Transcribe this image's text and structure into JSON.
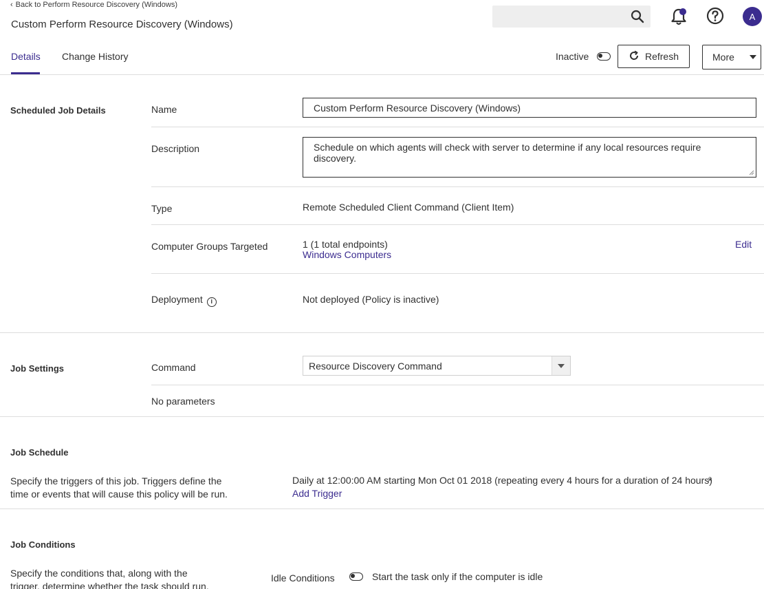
{
  "header": {
    "back_link": "Back to Perform Resource Discovery (Windows)",
    "title": "Custom Perform Resource Discovery (Windows)",
    "search_placeholder": "",
    "avatar_initial": "A"
  },
  "tabs": [
    {
      "label": "Details",
      "active": true
    },
    {
      "label": "Change History",
      "active": false
    }
  ],
  "actions": {
    "status_label": "Inactive",
    "refresh_label": "Refresh",
    "more_label": "More"
  },
  "scheduled_job_details": {
    "title": "Scheduled Job Details",
    "name_label": "Name",
    "name_value": "Custom Perform Resource Discovery (Windows)",
    "description_label": "Description",
    "description_value": "Schedule on which agents will check with server to determine if any local resources require discovery.",
    "type_label": "Type",
    "type_value": "Remote Scheduled Client Command (Client Item)",
    "groups_label": "Computer Groups Targeted",
    "groups_count": "1 (1 total endpoints)",
    "groups_link": "Windows Computers",
    "groups_edit": "Edit",
    "deployment_label": "Deployment",
    "deployment_value": "Not deployed (Policy is inactive)"
  },
  "job_settings": {
    "title": "Job Settings",
    "command_label": "Command",
    "command_value": "Resource Discovery Command",
    "no_parameters": "No parameters"
  },
  "job_schedule": {
    "title": "Job Schedule",
    "description": "Specify the triggers of this job. Triggers define the time or events that will cause this policy will be run.",
    "trigger": "Daily at 12:00:00 AM starting Mon Oct 01 2018 (repeating every 4 hours for a duration of 24 hours)",
    "remove_symbol": "×",
    "add_trigger": "Add Trigger"
  },
  "job_conditions": {
    "title": "Job Conditions",
    "description": "Specify the conditions that, along with the trigger, determine whether the task should run.",
    "idle_label": "Idle Conditions",
    "idle_option": "Start the task only if the computer is idle"
  },
  "colors": {
    "accent": "#3b2c8f",
    "text": "#303030",
    "divider": "#dddddd"
  },
  "icons": [
    "chevron-left-icon",
    "search-icon",
    "bell-icon",
    "help-icon",
    "refresh-icon",
    "caret-down-icon",
    "info-icon",
    "close-icon"
  ]
}
